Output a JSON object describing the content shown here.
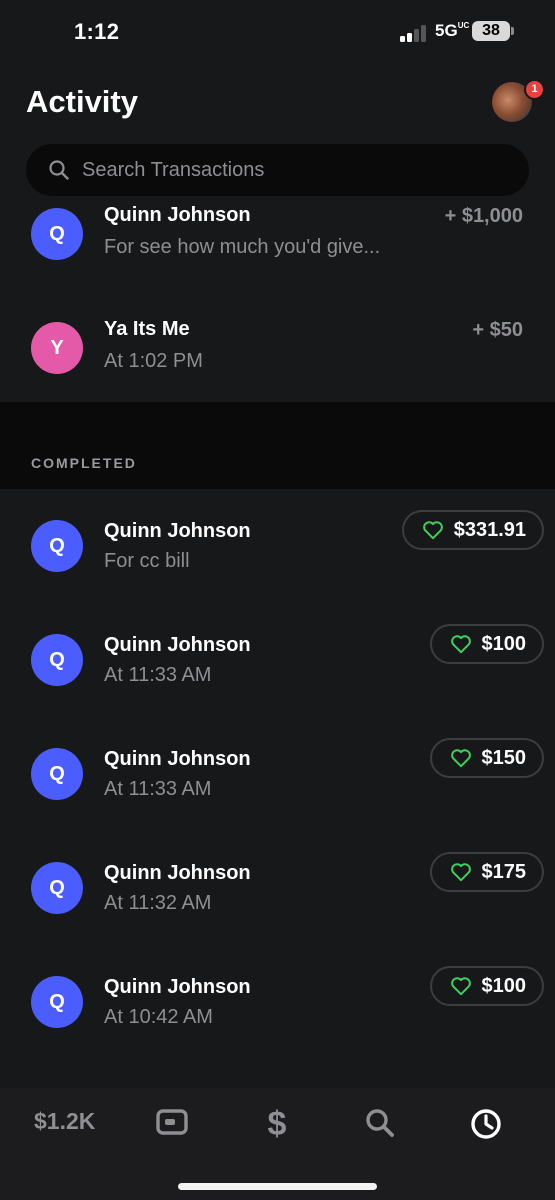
{
  "status_bar": {
    "time": "1:12",
    "network": "5G",
    "network_suffix": "UC",
    "battery": "38"
  },
  "header": {
    "title": "Activity",
    "notification_count": "1"
  },
  "search": {
    "placeholder": "Search Transactions"
  },
  "pending": [
    {
      "initial": "Q",
      "name": "Quinn Johnson",
      "subtitle": "For see how much you'd give...",
      "amount": "+ $1,000",
      "avatar_color": "#4b5dff"
    },
    {
      "initial": "Y",
      "name": "Ya Its Me",
      "subtitle": "At 1:02 PM",
      "amount": "+ $50",
      "avatar_color": "#e45aa8"
    }
  ],
  "completed_section": {
    "label": "COMPLETED",
    "items": [
      {
        "initial": "Q",
        "name": "Quinn Johnson",
        "subtitle": "For cc bill",
        "amount": "$331.91"
      },
      {
        "initial": "Q",
        "name": "Quinn Johnson",
        "subtitle": "At 11:33 AM",
        "amount": "$100"
      },
      {
        "initial": "Q",
        "name": "Quinn Johnson",
        "subtitle": "At 11:33 AM",
        "amount": "$150"
      },
      {
        "initial": "Q",
        "name": "Quinn Johnson",
        "subtitle": "At 11:32 AM",
        "amount": "$175"
      },
      {
        "initial": "Q",
        "name": "Quinn Johnson",
        "subtitle": "At 10:42 AM",
        "amount": "$100"
      }
    ]
  },
  "tab_bar": {
    "balance": "$1.2K",
    "tabs": [
      "card-icon",
      "dollar-icon",
      "search-icon",
      "clock-icon"
    ],
    "active_tab": "clock-icon"
  },
  "colors": {
    "background": "#17181a",
    "accent_blue": "#4b5dff",
    "heart_green": "#3ecf5c",
    "muted_text": "#8e8e93"
  }
}
